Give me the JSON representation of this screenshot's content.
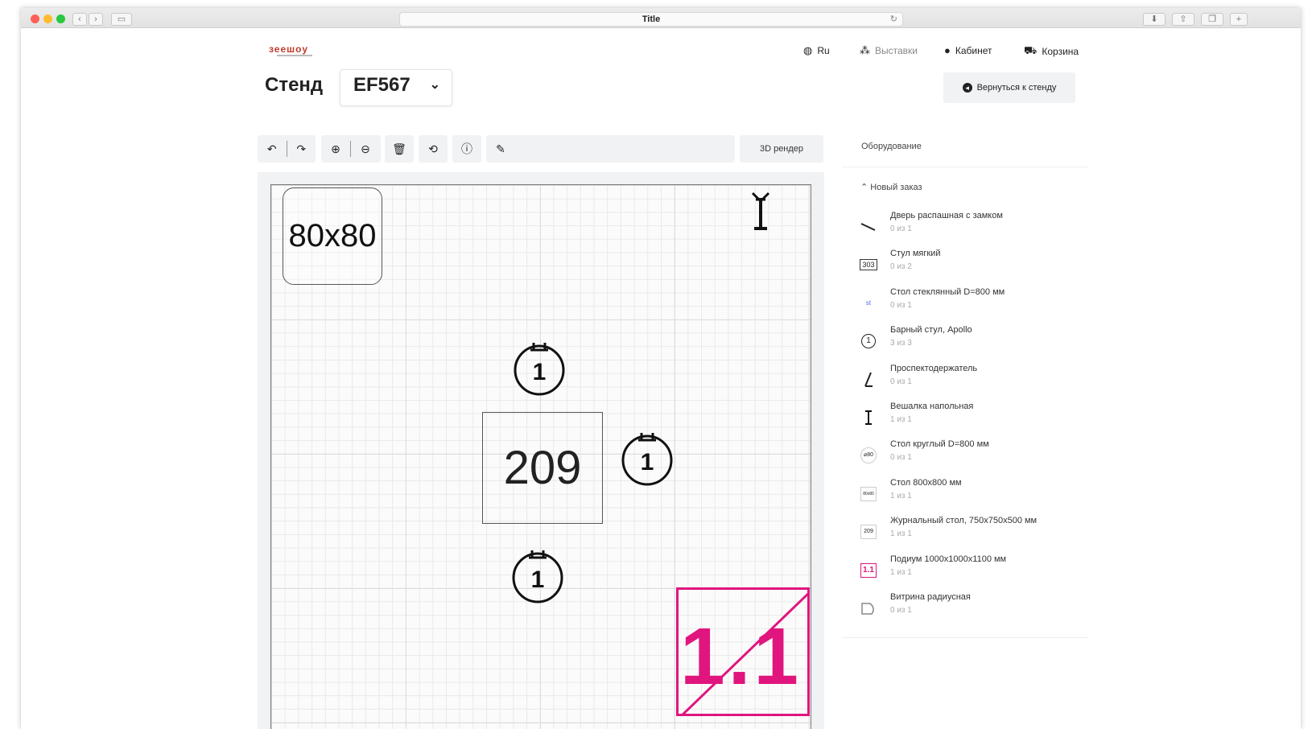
{
  "browser": {
    "title": "Title"
  },
  "header": {
    "logo": "зеешоу",
    "nav": [
      {
        "label": "Ru",
        "icon": "globe-icon"
      },
      {
        "label": "Выставки",
        "icon": "exhibitions-icon"
      },
      {
        "label": "Кабинет",
        "icon": "user-circle-icon"
      },
      {
        "label": "Корзина",
        "icon": "cart-icon"
      }
    ]
  },
  "page": {
    "title": "Стенд",
    "stand_code": "EF567",
    "back_label": "Вернуться к стенду"
  },
  "toolbar": {
    "tools": [
      "undo-icon",
      "redo-icon",
      "zoom-in-icon",
      "zoom-out-icon",
      "trash-icon",
      "rotate-icon",
      "help-icon",
      "pencil-icon"
    ],
    "render_label": "3D рендер"
  },
  "canvas": {
    "table_80": "80x80",
    "table_209": "209",
    "chair_label": "1",
    "podium_label": "1.1",
    "accent": "#e0157e"
  },
  "sidebar": {
    "header": "Оборудование",
    "order_title": "Новый заказ",
    "items": [
      {
        "name": "Дверь распашная с замком",
        "qty": "0 из 1",
        "icon": "door-icon"
      },
      {
        "name": "Стул мягкий",
        "qty": "0 из 2",
        "icon": "chair-icon",
        "badge": "303"
      },
      {
        "name": "Стол стеклянный D=800 мм",
        "qty": "0 из 1",
        "icon": "glass-table-icon",
        "badge": "st"
      },
      {
        "name": "Барный стул, Apollo",
        "qty": "3 из 3",
        "icon": "bar-stool-icon",
        "badge": "1"
      },
      {
        "name": "Проспектодержатель",
        "qty": "0 из 1",
        "icon": "brochure-holder-icon"
      },
      {
        "name": "Вешалка напольная",
        "qty": "1 из 1",
        "icon": "coat-rack-icon"
      },
      {
        "name": "Стол круглый D=800 мм",
        "qty": "0 из 1",
        "icon": "round-table-icon",
        "badge": "⌀80"
      },
      {
        "name": "Стол 800х800 мм",
        "qty": "1 из 1",
        "icon": "square-table-icon",
        "badge": "80x80"
      },
      {
        "name": "Журнальный стол, 750х750х500 мм",
        "qty": "1 из 1",
        "icon": "coffee-table-icon",
        "badge": "209"
      },
      {
        "name": "Подиум 1000х1000х1100 мм",
        "qty": "1 из 1",
        "icon": "podium-icon",
        "badge": "1.1"
      },
      {
        "name": "Витрина радиусная",
        "qty": "0 из 1",
        "icon": "showcase-icon"
      }
    ]
  }
}
